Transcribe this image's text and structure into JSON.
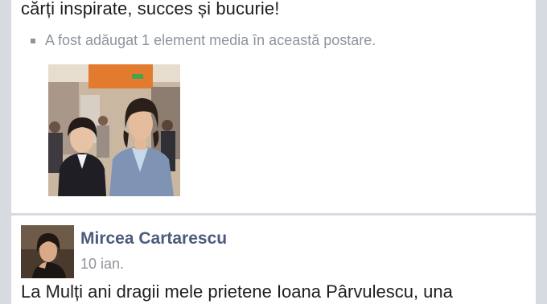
{
  "post1": {
    "text_tail": "cărți inspirate, succes și bucurie!",
    "media_note": "A fost adăugat 1 element media în această postare.",
    "photo_alt": "photo"
  },
  "post2": {
    "author": "Mircea Cartarescu",
    "date": "10 ian.",
    "text_start": "La Mulți ani dragii mele prietene Ioana Pârvulescu, una"
  },
  "colors": {
    "feed_bg": "#d7dae0",
    "card_bg": "#ffffff",
    "author_name": "#4b5b7d",
    "meta_gray": "#8d949e"
  }
}
